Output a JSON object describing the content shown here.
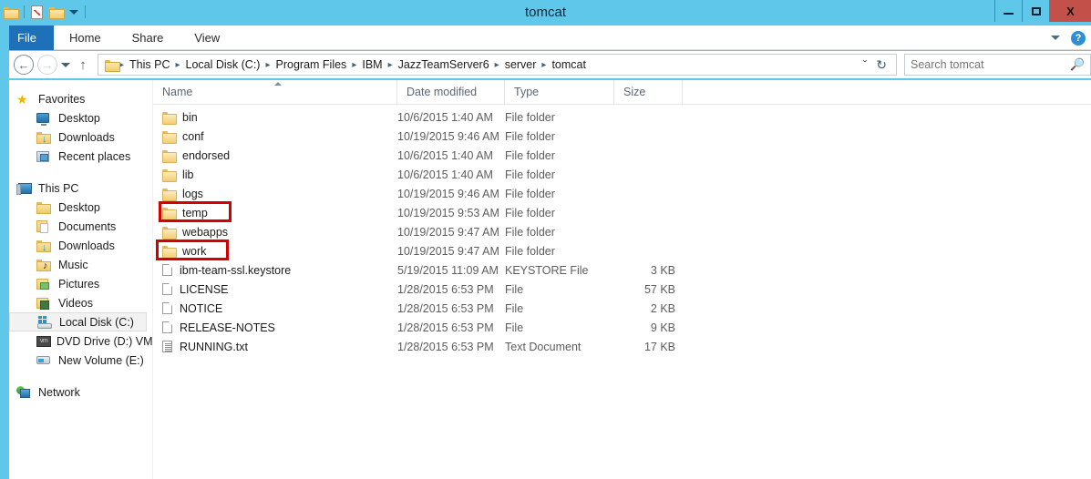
{
  "window": {
    "title": "tomcat",
    "accent_color": "#5fc7ea",
    "close_color": "#c4504a",
    "highlight_color": "#d40000",
    "controls": {
      "minimize": "minimize-button",
      "maximize": "maximize-button",
      "close": "X"
    }
  },
  "quick_access": {
    "items": [
      {
        "name": "folder-icon",
        "label": ""
      },
      {
        "name": "properties-icon",
        "label": ""
      },
      {
        "name": "new-folder-icon",
        "label": ""
      },
      {
        "name": "customize-caret-icon",
        "label": ""
      }
    ]
  },
  "ribbon": {
    "tabs": [
      {
        "label": "File",
        "active": true
      },
      {
        "label": "Home",
        "active": false
      },
      {
        "label": "Share",
        "active": false
      },
      {
        "label": "View",
        "active": false
      }
    ],
    "minimize_ribbon_icon": "chevron-down-icon",
    "help_icon": "?"
  },
  "addressbar": {
    "back": "←",
    "forward": "→",
    "recent_caret": "chevron-down-icon",
    "up": "↑",
    "breadcrumbs": [
      "This PC",
      "Local Disk (C:)",
      "Program Files",
      "IBM",
      "JazzTeamServer6",
      "server",
      "tomcat"
    ],
    "separator": "▸",
    "history_caret": "ˇ",
    "refresh": "↻"
  },
  "search": {
    "placeholder": "Search tomcat",
    "value": "",
    "icon": "search-icon"
  },
  "sidebar": {
    "groups": [
      {
        "header": {
          "label": "Favorites",
          "icon": "star-icon"
        },
        "items": [
          {
            "label": "Desktop",
            "icon": "monitor-icon"
          },
          {
            "label": "Downloads",
            "icon": "download-folder-icon"
          },
          {
            "label": "Recent places",
            "icon": "recent-places-icon"
          }
        ]
      },
      {
        "header": {
          "label": "This PC",
          "icon": "computer-icon"
        },
        "items": [
          {
            "label": "Desktop",
            "icon": "desktop-folder-icon"
          },
          {
            "label": "Documents",
            "icon": "documents-icon"
          },
          {
            "label": "Downloads",
            "icon": "download-folder-icon"
          },
          {
            "label": "Music",
            "icon": "music-folder-icon"
          },
          {
            "label": "Pictures",
            "icon": "pictures-folder-icon"
          },
          {
            "label": "Videos",
            "icon": "videos-folder-icon"
          },
          {
            "label": "Local Disk (C:)",
            "icon": "local-disk-icon",
            "selected": true
          },
          {
            "label": "DVD Drive (D:) VMw",
            "icon": "dvd-drive-icon"
          },
          {
            "label": "New Volume (E:)",
            "icon": "drive-icon"
          }
        ]
      },
      {
        "header": {
          "label": "Network",
          "icon": "network-icon"
        },
        "items": []
      }
    ]
  },
  "filelist": {
    "columns": [
      {
        "key": "name",
        "label": "Name",
        "sorted": "asc"
      },
      {
        "key": "date",
        "label": "Date modified"
      },
      {
        "key": "type",
        "label": "Type"
      },
      {
        "key": "size",
        "label": "Size"
      }
    ],
    "rows": [
      {
        "name": "bin",
        "date": "10/6/2015 1:40 AM",
        "type": "File folder",
        "size": "",
        "icon": "folder-icon",
        "highlighted": false
      },
      {
        "name": "conf",
        "date": "10/19/2015 9:46 AM",
        "type": "File folder",
        "size": "",
        "icon": "folder-icon",
        "highlighted": false
      },
      {
        "name": "endorsed",
        "date": "10/6/2015 1:40 AM",
        "type": "File folder",
        "size": "",
        "icon": "folder-icon",
        "highlighted": false
      },
      {
        "name": "lib",
        "date": "10/6/2015 1:40 AM",
        "type": "File folder",
        "size": "",
        "icon": "folder-icon",
        "highlighted": false
      },
      {
        "name": "logs",
        "date": "10/19/2015 9:46 AM",
        "type": "File folder",
        "size": "",
        "icon": "folder-icon",
        "highlighted": false
      },
      {
        "name": "temp",
        "date": "10/19/2015 9:53 AM",
        "type": "File folder",
        "size": "",
        "icon": "folder-icon",
        "highlighted": true
      },
      {
        "name": "webapps",
        "date": "10/19/2015 9:47 AM",
        "type": "File folder",
        "size": "",
        "icon": "folder-icon",
        "highlighted": false
      },
      {
        "name": "work",
        "date": "10/19/2015 9:47 AM",
        "type": "File folder",
        "size": "",
        "icon": "folder-icon",
        "highlighted": true
      },
      {
        "name": "ibm-team-ssl.keystore",
        "date": "5/19/2015 11:09 AM",
        "type": "KEYSTORE File",
        "size": "3 KB",
        "icon": "file-icon",
        "highlighted": false
      },
      {
        "name": "LICENSE",
        "date": "1/28/2015 6:53 PM",
        "type": "File",
        "size": "57 KB",
        "icon": "file-icon",
        "highlighted": false
      },
      {
        "name": "NOTICE",
        "date": "1/28/2015 6:53 PM",
        "type": "File",
        "size": "2 KB",
        "icon": "file-icon",
        "highlighted": false
      },
      {
        "name": "RELEASE-NOTES",
        "date": "1/28/2015 6:53 PM",
        "type": "File",
        "size": "9 KB",
        "icon": "file-icon",
        "highlighted": false
      },
      {
        "name": "RUNNING.txt",
        "date": "1/28/2015 6:53 PM",
        "type": "Text Document",
        "size": "17 KB",
        "icon": "text-document-icon",
        "highlighted": false
      }
    ]
  }
}
